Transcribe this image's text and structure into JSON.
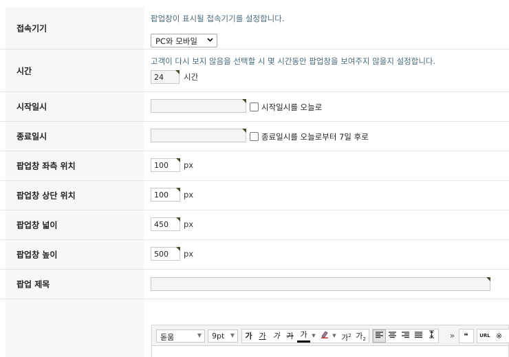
{
  "device": {
    "label": "접속기기",
    "help": "팝업창이 표시될 접속기기를 설정합니다.",
    "selected": "PC와 모바일"
  },
  "time": {
    "label": "시간",
    "help": "고객이 다시 보지 않음을 선택할 시 몇 시간동안 팝업창을 보여주지 않을지 설정합니다.",
    "value": "24",
    "unit": "시간"
  },
  "start": {
    "label": "시작일시",
    "value": "",
    "checkbox_label": "시작일시를 오늘로"
  },
  "end": {
    "label": "종료일시",
    "value": "",
    "checkbox_label": "종료일시를 오늘로부터 7일 후로"
  },
  "left_pos": {
    "label": "팝업창 좌측 위치",
    "value": "100",
    "unit": "px"
  },
  "top_pos": {
    "label": "팝업창 상단 위치",
    "value": "100",
    "unit": "px"
  },
  "width": {
    "label": "팝업창 넓이",
    "value": "450",
    "unit": "px"
  },
  "height": {
    "label": "팝업창 높이",
    "value": "500",
    "unit": "px"
  },
  "title": {
    "label": "팝업 제목",
    "value": ""
  },
  "toolbar": {
    "font": "돋움",
    "size": "9pt",
    "bold": "가",
    "underline": "가",
    "italic": "가",
    "strike": "가",
    "fontcolor": "가",
    "sup": "가",
    "sub": "가",
    "more": "»",
    "quote": "❝",
    "url": "URL",
    "special": "※"
  }
}
